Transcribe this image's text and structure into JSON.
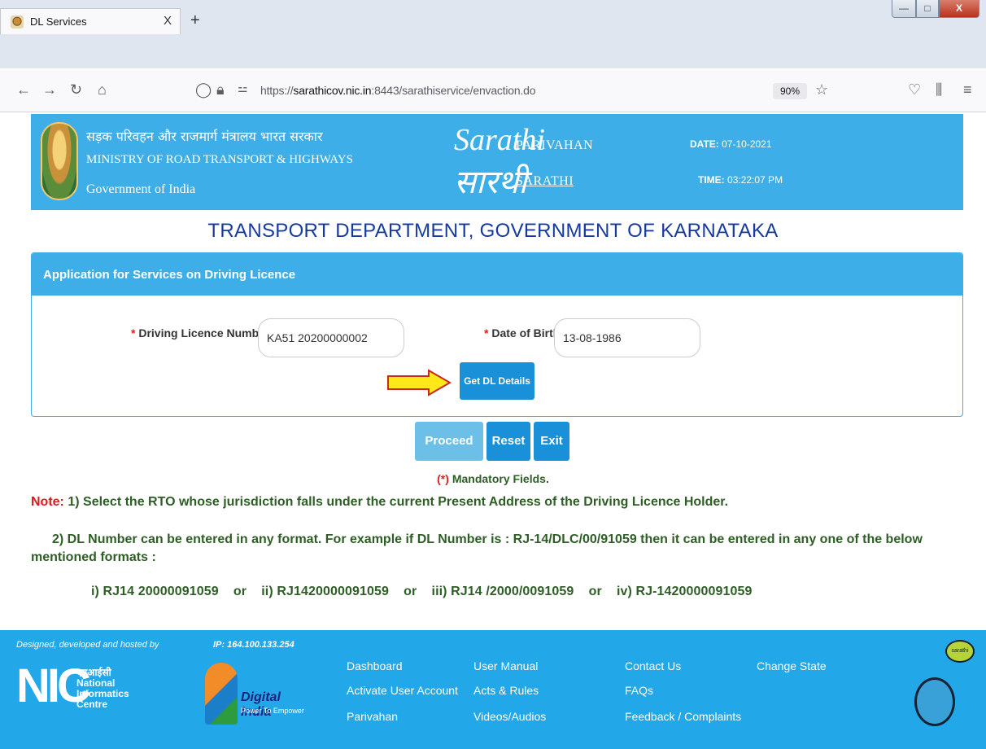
{
  "browser": {
    "tab_title": "DL Services",
    "tab_close": "X",
    "new_tab": "+",
    "url_prefix": "https://",
    "url_host": "sarathicov.nic.in",
    "url_rest": ":8443/sarathiservice/envaction.do",
    "zoom": "90%"
  },
  "header": {
    "ministry_hindi": "सड़क परिवहन और राजमार्ग मंत्रालय भारत सरकार",
    "ministry_english": "MINISTRY OF ROAD TRANSPORT & HIGHWAYS",
    "government": "Government of India",
    "logo_top": "Sarathi",
    "logo_bottom": "सारथी",
    "parivahan": "PARIVAHAN",
    "sarathi": "SARATHI",
    "date_label": "DATE:",
    "date_value": "07-10-2021",
    "time_label": "TIME:",
    "time_value": "03:22:07 PM"
  },
  "department": "TRANSPORT DEPARTMENT, GOVERNMENT OF KARNATAKA",
  "form": {
    "panel_title": "Application for Services on Driving Licence",
    "required_mark": "*",
    "dl_label": "Driving Licence Number",
    "dl_value": "KA51 20200000002",
    "dob_label": "Date of Birth",
    "dob_value": "13-08-1986",
    "get_details": "Get DL Details"
  },
  "actions": {
    "proceed": "Proceed",
    "reset": "Reset",
    "exit": "Exit"
  },
  "mandatory_mark": "(*)",
  "mandatory_text": "Mandatory Fields.",
  "notes": {
    "note_label": "Note:",
    "note1": "1) Select the RTO whose jurisdiction falls under the current Present Address of the Driving Licence Holder.",
    "note2": "2) DL Number can be entered in any format. For example if DL Number is : RJ-14/DLC/00/91059 then it can be entered in any one of the below mentioned formats :",
    "note3": "i) RJ14 20000091059    or    ii) RJ1420000091059    or    iii) RJ14 /2000/0091059    or    iv) RJ-1420000091059"
  },
  "footer": {
    "designed_by": "Designed, developed and hosted by",
    "ip": "IP: 164.100.133.254",
    "nic_hindi": "एनआईसी",
    "nic_line1": "National",
    "nic_line2": "Informatics",
    "nic_line3": "Centre",
    "nic_letters": "NIC",
    "digital_india": "Digital India",
    "digital_tag": "Power To Empower",
    "links": {
      "dashboard": "Dashboard",
      "activate": "Activate User Account",
      "parivahan": "Parivahan",
      "manual": "User Manual",
      "acts": "Acts & Rules",
      "videos": "Videos/Audios",
      "contact": "Contact Us",
      "faqs": "FAQs",
      "feedback": "Feedback / Complaints",
      "change_state": "Change State"
    },
    "mascot_bubble": "sarathi"
  },
  "colors": {
    "header_blue": "#3daee8",
    "button_blue": "#1a90d8",
    "department_text": "#163aa0",
    "note_green": "#2e5e26",
    "note_red": "#d41e1e",
    "arrow_yellow": "#ffe81a"
  }
}
